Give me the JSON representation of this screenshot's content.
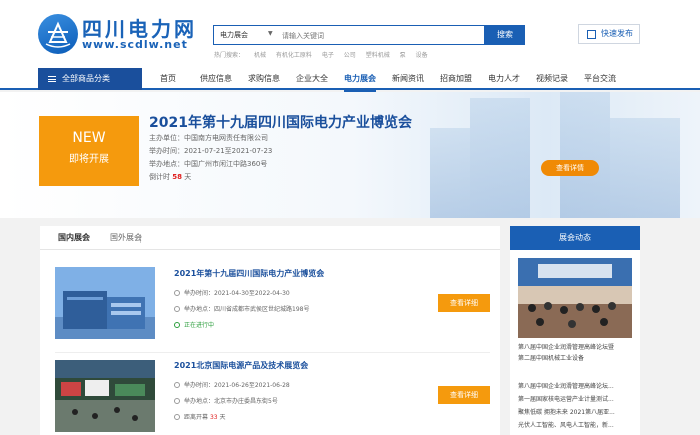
{
  "site": {
    "name_cn": "四川电力网",
    "domain": "www.scdlw.net"
  },
  "search": {
    "category": "电力展会",
    "placeholder": "请输入关键词",
    "button": "搜索",
    "hot_label": "热门搜索：",
    "hot_keywords": [
      "机械",
      "有机化工原料",
      "电子",
      "公司",
      "塑料机械",
      "泵",
      "设备"
    ]
  },
  "publish": {
    "label": "快速发布"
  },
  "nav": {
    "all_categories": "全部商品分类",
    "items": [
      "首页",
      "供应信息",
      "求购信息",
      "企业大全",
      "电力展会",
      "新闻资讯",
      "招商加盟",
      "电力人才",
      "视频记录",
      "平台交流"
    ],
    "active": "电力展会"
  },
  "banner": {
    "badge_top": "NEW",
    "badge_bottom": "即将开展",
    "title": "2021年第十九届四川国际电力产业博览会",
    "organizer": "主办单位：中国南方电网责任有限公司",
    "time": "举办时间：2021-07-21至2021-07-23",
    "location": "举办地点：中国广州市闲江中路360号",
    "countdown_prefix": "倒计时",
    "countdown_days": "58",
    "countdown_suffix": "天",
    "button": "查看详情"
  },
  "tabs": [
    "国内展会",
    "国外展会"
  ],
  "expos": [
    {
      "title": "2021年第十九届四川国际电力产业博览会",
      "time": "举办时间：2021-04-30至2022-04-30",
      "location": "举办地点：四川省成都市武侯区世纪城路198号",
      "status": "正在进行中",
      "button": "查看详细"
    },
    {
      "title": "2021北京国际电源产品及技术展览会",
      "time": "举办时间：2021-06-26至2021-06-28",
      "location": "举办地点：北京市办庄委昌东街5号",
      "status_prefix": "距离开幕",
      "days": "33",
      "status_suffix": "天",
      "button": "查看详细"
    }
  ],
  "sidebar": {
    "title": "展会动态",
    "news": [
      "第八届中国企业润滑管理高峰论坛暨",
      "第二届中国机械工业设备",
      "第八届中国企业润滑管理高峰论坛...",
      "第一届国家核电运营产业计量测试...",
      "聚焦低碳 拥抱未来 2021第八届亚...",
      "光伏人工智能、风电人工智能，新..."
    ]
  },
  "colors": {
    "brand_blue": "#1a5fb4",
    "accent_orange": "#f59a0d",
    "alert_red": "#e02020",
    "status_green": "#2a9d3b"
  }
}
